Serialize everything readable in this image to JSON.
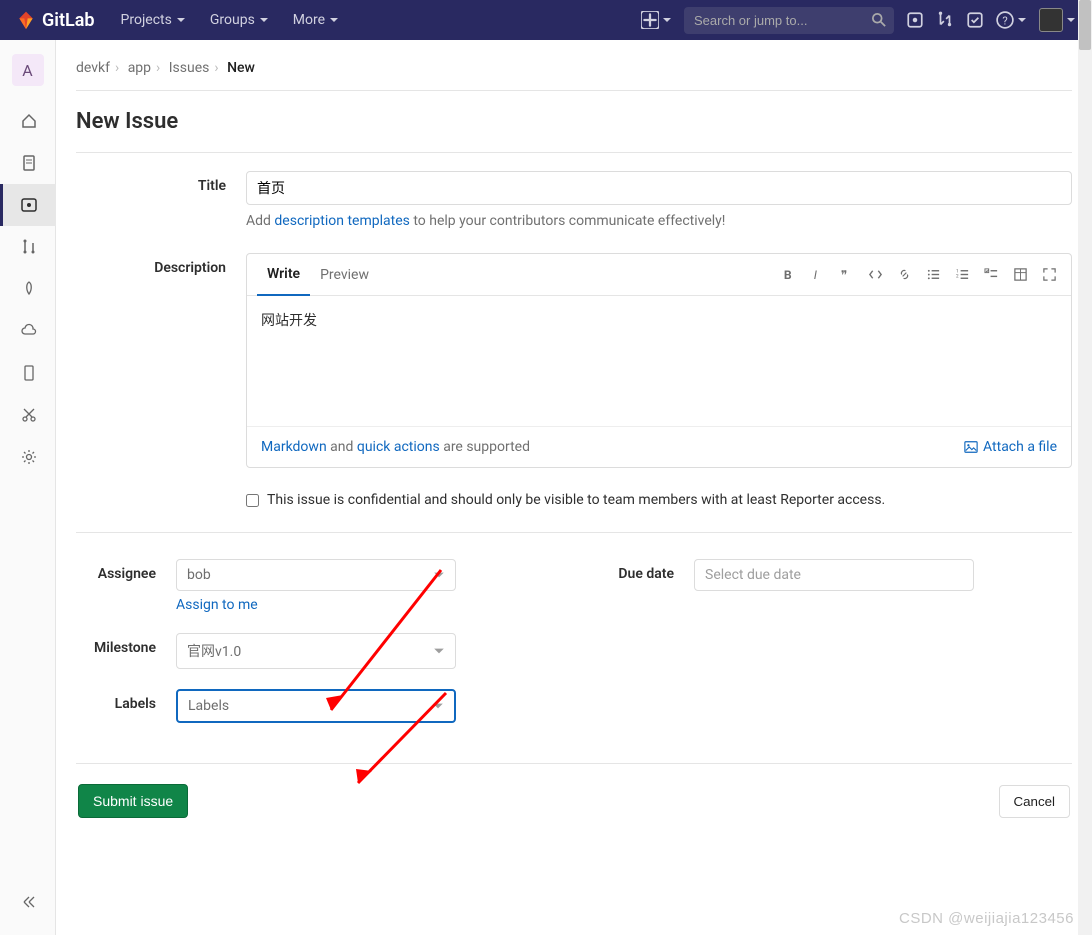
{
  "brand": "GitLab",
  "nav": {
    "projects": "Projects",
    "groups": "Groups",
    "more": "More"
  },
  "search": {
    "placeholder": "Search or jump to..."
  },
  "sidebar_avatar": "A",
  "breadcrumb": [
    "devkf",
    "app",
    "Issues",
    "New"
  ],
  "page_title": "New Issue",
  "labels": {
    "title": "Title",
    "description": "Description",
    "assignee": "Assignee",
    "due_date": "Due date",
    "milestone": "Milestone",
    "labels": "Labels"
  },
  "title_value": "首页",
  "template_help": {
    "pre": "Add ",
    "link": "description templates",
    "post": " to help your contributors communicate effectively!"
  },
  "editor": {
    "tabs": {
      "write": "Write",
      "preview": "Preview"
    },
    "body": "网站开发",
    "footer_parts": {
      "md": "Markdown",
      "and": " and ",
      "qa": "quick actions",
      "tail": " are supported"
    },
    "attach": "Attach a file"
  },
  "confidential_text": "This issue is confidential and should only be visible to team members with at least Reporter access.",
  "assignee_value": "bob",
  "assign_link": "Assign to me",
  "milestone_value": "官网v1.0",
  "labels_placeholder": "Labels",
  "due_date_placeholder": "Select due date",
  "buttons": {
    "submit": "Submit issue",
    "cancel": "Cancel"
  },
  "watermark": "CSDN @weijiajia123456"
}
